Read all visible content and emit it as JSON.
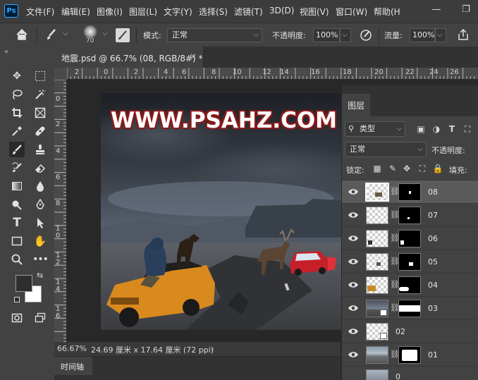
{
  "app": {
    "logo": "Ps"
  },
  "menu": {
    "items": [
      "文件(F)",
      "编辑(E)",
      "图像(I)",
      "图层(L)",
      "文字(Y)",
      "选择(S)",
      "滤镜(T)",
      "3D(D)",
      "视图(V)",
      "窗口(W)",
      "帮助(H"
    ]
  },
  "window_controls": {
    "minimize": "—",
    "restore": "❐"
  },
  "options": {
    "brush_size": "70",
    "mode_label": "模式:",
    "mode_value": "正常",
    "opacity_label": "不透明度:",
    "opacity_value": "100%",
    "flow_label": "流量:",
    "flow_value": "100%"
  },
  "document": {
    "tab_title": "地震.psd @ 66.7% (08, RGB/8#) *",
    "close": "×"
  },
  "rulers": {
    "top": [
      "2",
      "0",
      "2",
      "4",
      "6",
      "8",
      "10",
      "12",
      "14",
      "16",
      "18",
      "20",
      "22",
      "24",
      "26"
    ],
    "left": [
      "0",
      "2",
      "4",
      "6",
      "8",
      "1\n0",
      "1\n2",
      "1\n4",
      "1\n6"
    ]
  },
  "canvas": {
    "watermark": "WWW.PSAHZ.COM"
  },
  "status": {
    "zoom": "66.67%",
    "size": "24.69 厘米 x 17.64 厘米 (72 ppi)",
    "arrow": "›"
  },
  "timeline": {
    "label": "时间轴"
  },
  "layers_panel": {
    "title": "图层",
    "filter_value": "类型",
    "blend_mode": "正常",
    "opacity_label": "不透明度:",
    "lock_label": "锁定:",
    "fill_label": "填充:",
    "layers": [
      {
        "name": "08",
        "selected": true
      },
      {
        "name": "07",
        "selected": false
      },
      {
        "name": "06",
        "selected": false
      },
      {
        "name": "05",
        "selected": false
      },
      {
        "name": "04",
        "selected": false
      },
      {
        "name": "03",
        "selected": false
      },
      {
        "name": "02",
        "selected": false
      },
      {
        "name": "01",
        "selected": false
      },
      {
        "name": "0",
        "selected": false
      }
    ]
  },
  "colors": {
    "foreground": "#2e2e2e",
    "background": "#ffffff",
    "accent": "#31a8ff",
    "panel": "#424242",
    "watermark_outline": "#8a1a1a"
  },
  "icons": {
    "home": "home-icon",
    "brush": "brush-icon",
    "eye": "eye-icon",
    "chain": "link-icon"
  }
}
